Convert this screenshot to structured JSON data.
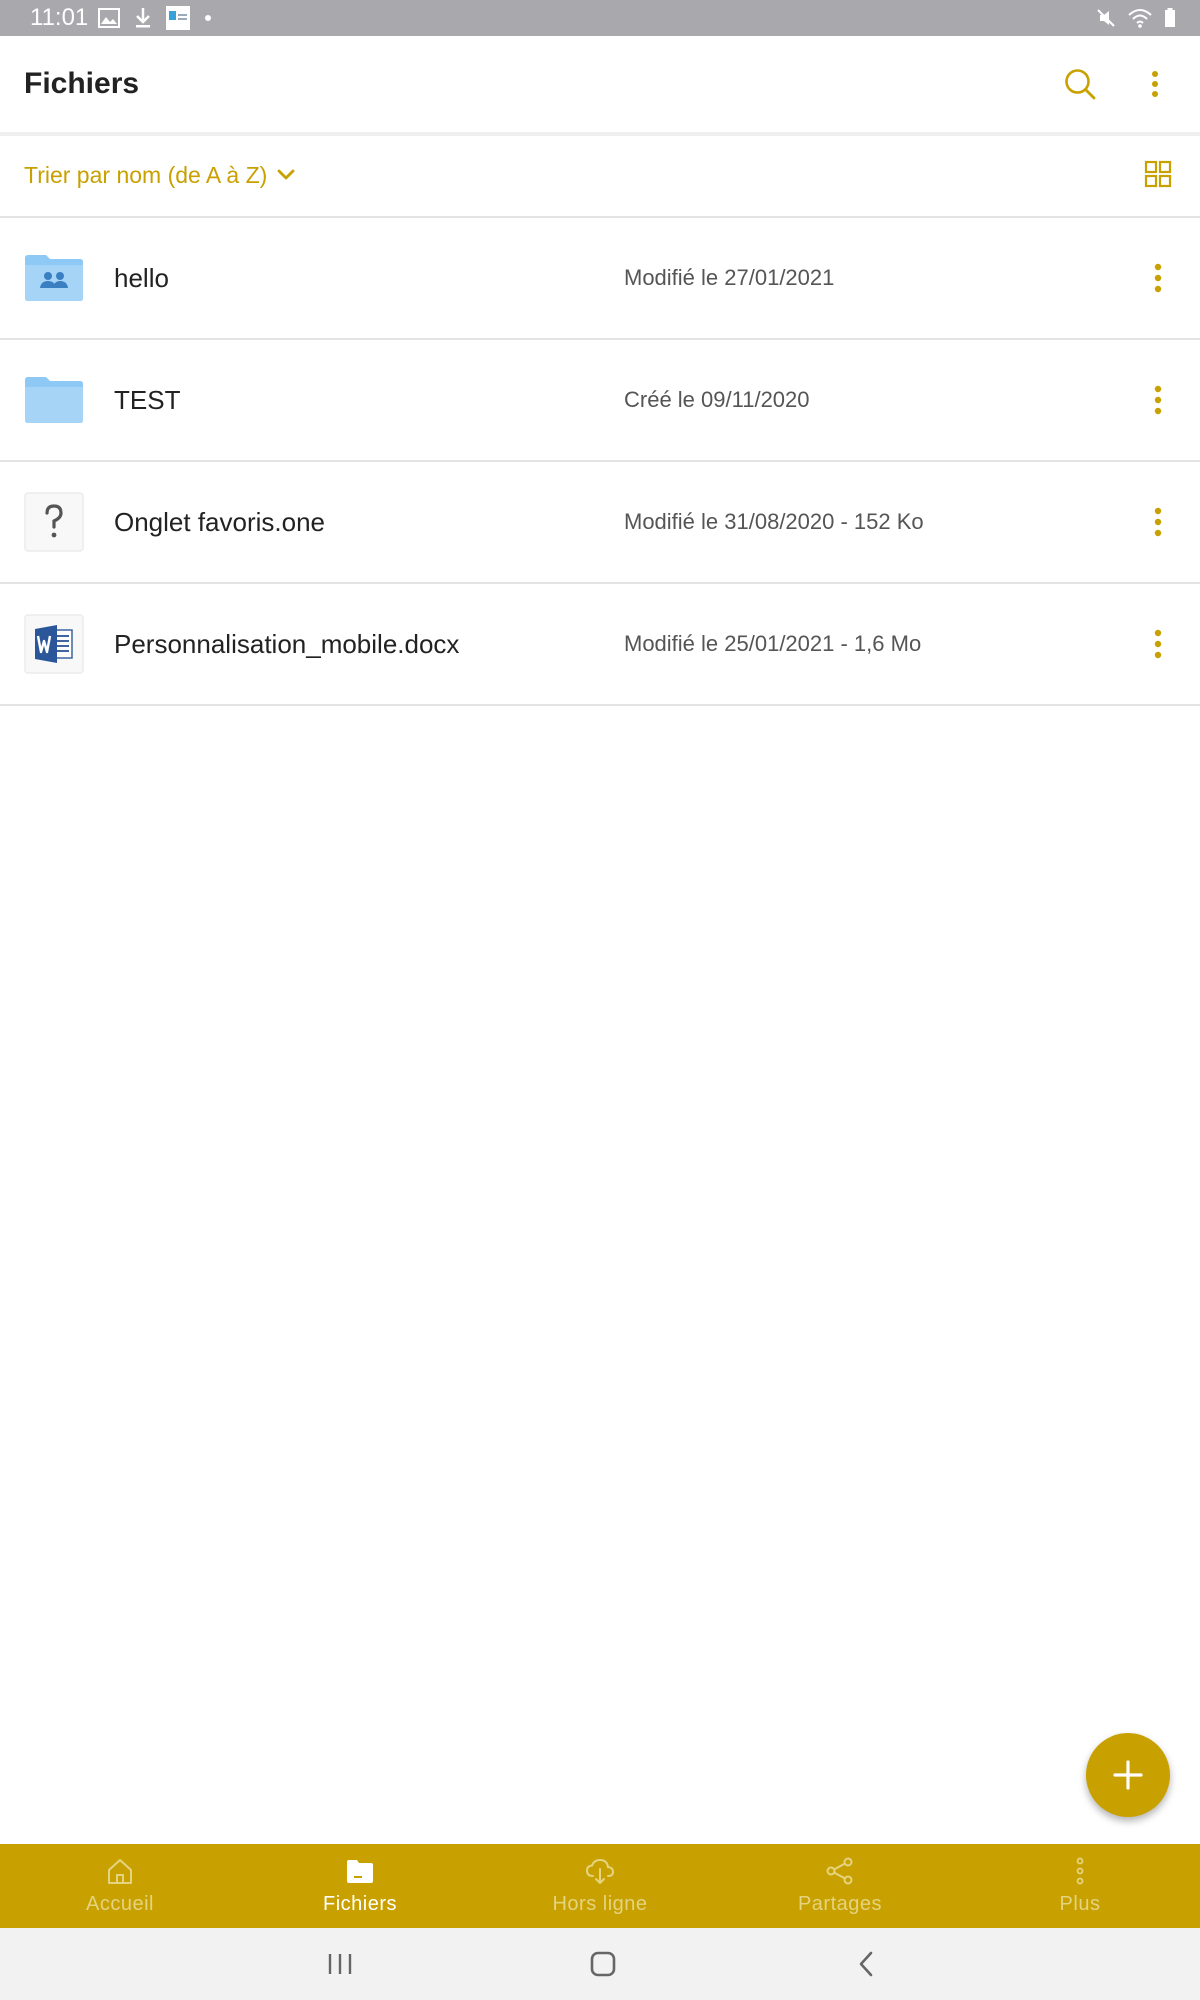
{
  "status_bar": {
    "time": "11:01"
  },
  "app_bar": {
    "title": "Fichiers"
  },
  "sort": {
    "label": "Trier par nom (de A à Z)"
  },
  "files": [
    {
      "name": "hello",
      "meta": "Modifié le 27/01/2021",
      "icon": "shared-folder-icon"
    },
    {
      "name": "TEST",
      "meta": "Créé le 09/11/2020",
      "icon": "folder-icon"
    },
    {
      "name": "Onglet favoris.one",
      "meta": "Modifié le 31/08/2020 - 152 Ko",
      "icon": "unknown-file-icon"
    },
    {
      "name": "Personnalisation_mobile.docx",
      "meta": "Modifié le 25/01/2021 - 1,6 Mo",
      "icon": "word-document-icon"
    }
  ],
  "bottom_nav": {
    "items": [
      {
        "label": "Accueil",
        "icon": "home-icon",
        "active": false
      },
      {
        "label": "Fichiers",
        "icon": "folder-icon",
        "active": true
      },
      {
        "label": "Hors ligne",
        "icon": "cloud-download-icon",
        "active": false
      },
      {
        "label": "Partages",
        "icon": "share-icon",
        "active": false
      },
      {
        "label": "Plus",
        "icon": "more-vertical-icon",
        "active": false
      }
    ]
  },
  "colors": {
    "accent": "#c8a100",
    "status_bar": "#a9a9ad",
    "folder": "#8ec8f4"
  }
}
